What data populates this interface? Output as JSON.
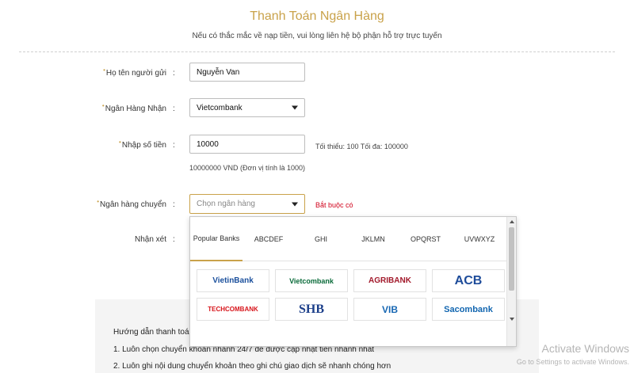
{
  "header": {
    "title": "Thanh Toán Ngân Hàng",
    "subtitle": "Nếu có thắc mắc về nạp tiền, vui lòng liên hệ bộ phận hỗ trợ trực tuyến"
  },
  "form": {
    "sender_name": {
      "label": "Họ tên người gửi",
      "value": "Nguyễn Van"
    },
    "receiving_bank": {
      "label": "Ngân Hàng Nhận",
      "value": "Vietcombank"
    },
    "amount": {
      "label": "Nhập số tiền",
      "value": "10000",
      "limit_note": "Tối thiểu: 100 Tối đa: 100000",
      "converted": "10000000 VND (Đơn vị tính là 1000)"
    },
    "sending_bank": {
      "label": "Ngân hàng chuyển",
      "placeholder": "Chọn ngân hàng",
      "required": "Bắt buộc có"
    },
    "comment": {
      "label": "Nhận xét"
    },
    "colon": ":"
  },
  "dropdown": {
    "tabs": [
      "Popular Banks",
      "ABCDEF",
      "GHI",
      "JKLMN",
      "OPQRST",
      "UVWXYZ"
    ],
    "active_tab": 0,
    "banks": [
      {
        "name": "VietinBank",
        "color": "#1a4f9c"
      },
      {
        "name": "Vietcombank",
        "color": "#0a6b3a"
      },
      {
        "name": "AGRIBANK",
        "color": "#a2192b"
      },
      {
        "name": "ACB",
        "color": "#1e4c9a"
      },
      {
        "name": "TECHCOMBANK",
        "color": "#d7141a"
      },
      {
        "name": "SHB",
        "color": "#1c3f8a"
      },
      {
        "name": "VIB",
        "color": "#1767b3"
      },
      {
        "name": "Sacombank",
        "color": "#1266b0"
      }
    ]
  },
  "guide": {
    "heading": "Hướng dẫn thanh toá",
    "lines": [
      "1. Luôn chọn chuyển khoản nhanh 24/7 để được cập nhật tiền nhanh nhất",
      "2. Luôn ghi nội dung chuyển khoản theo ghi chú giao dịch sẽ nhanh chóng hơn"
    ]
  },
  "watermark": {
    "line1": "Activate Windows",
    "line2": "Go to Settings to activate Windows."
  },
  "colors": {
    "accent": "#c9a24a",
    "required": "#d0021b"
  }
}
